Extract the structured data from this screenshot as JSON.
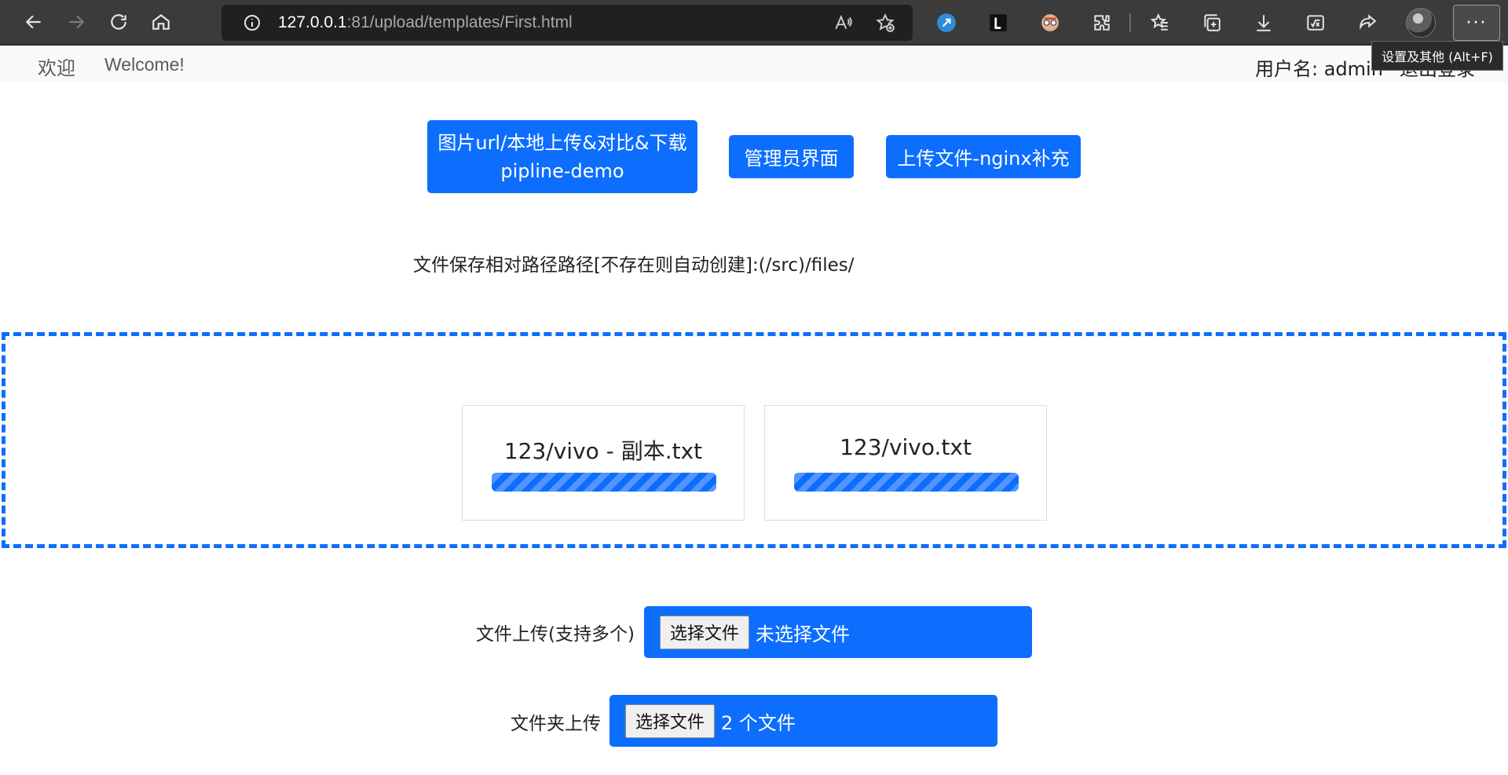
{
  "browser": {
    "address_host": "127.0.0.1",
    "address_rest": ":81/upload/templates/First.html",
    "tooltip": "设置及其他 (Alt+F)",
    "more_label": "···",
    "icons": [
      "back-icon",
      "forward-icon",
      "refresh-icon",
      "home-icon",
      "site-info-icon",
      "read-aloud-icon",
      "add-favorite-icon",
      "extension-icon",
      "favorites-icon",
      "collections-icon",
      "downloads-icon",
      "math-solver-icon",
      "share-icon",
      "more-icon"
    ]
  },
  "navbar": {
    "brand": "欢迎",
    "welcome": "Welcome!",
    "user_prefix": "用户名: ",
    "username": "admin",
    "logout": "退出登录"
  },
  "actions": {
    "pipline_line1": "图片url/本地上传&对比&下载",
    "pipline_line2": "pipline-demo",
    "admin": "管理员界面",
    "nginx": "上传文件-nginx补充"
  },
  "path_info": "文件保存相对路径路径[不存在则自动创建]:(/src)/files/",
  "uploads": {
    "files": [
      {
        "name": "123/vivo - 副本.txt",
        "progress": 1.0
      },
      {
        "name": "123/vivo.txt",
        "progress": 1.0
      }
    ]
  },
  "upload_multi": {
    "label": "文件上传(支持多个)",
    "button": "选择文件",
    "status": "未选择文件"
  },
  "upload_folder": {
    "label": "文件夹上传",
    "button": "选择文件",
    "status": "2 个文件"
  },
  "colors": {
    "primary": "#0d6efd",
    "navbar_bg": "#f8f9fa",
    "chrome_bg": "#3b3b3b"
  }
}
